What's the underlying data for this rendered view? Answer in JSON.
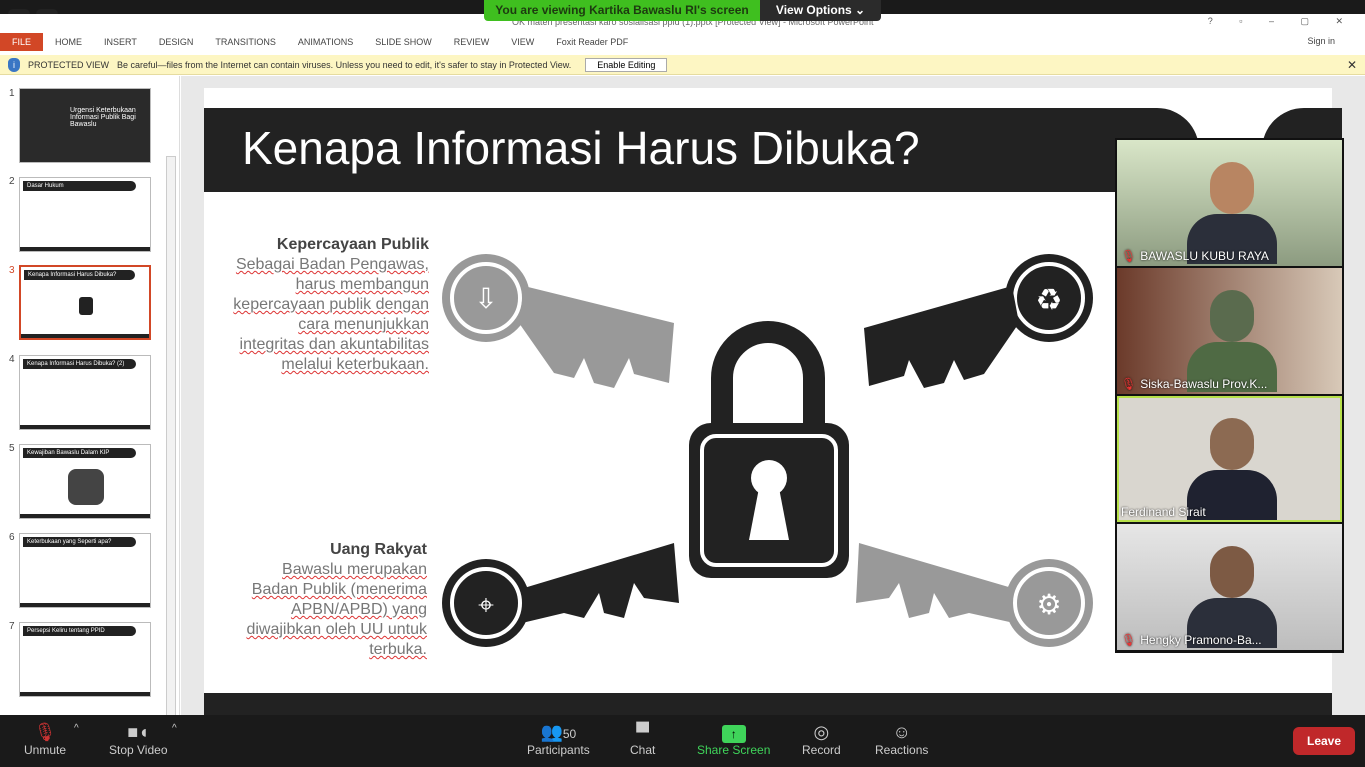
{
  "zoom": {
    "banner": "You are viewing Kartika Bawaslu RI's screen",
    "view_options": "View Options ⌄",
    "toolbar": [
      {
        "label": "Unmute",
        "icon": "mic-muted-icon"
      },
      {
        "label": "Stop Video",
        "icon": "video-camera-icon"
      },
      {
        "label": "Participants",
        "icon": "participants-icon",
        "count": "50"
      },
      {
        "label": "Chat",
        "icon": "chat-icon"
      },
      {
        "label": "Share Screen",
        "icon": "share-screen-icon"
      },
      {
        "label": "Record",
        "icon": "record-icon"
      },
      {
        "label": "Reactions",
        "icon": "reactions-icon"
      }
    ],
    "leave": "Leave",
    "participants": [
      {
        "name": "BAWASLU KUBU RAYA"
      },
      {
        "name": "Siska-Bawaslu Prov.K..."
      },
      {
        "name": "Ferdinand Sirait"
      },
      {
        "name": "Hengky Pramono-Ba..."
      }
    ]
  },
  "window": {
    "title": "OK materi presentasi karo sosialisasi ppid (1).pptx [Protected View] - Microsoft PowerPoint",
    "sign_in": "Sign in"
  },
  "ribbon": {
    "tabs": [
      "FILE",
      "HOME",
      "INSERT",
      "DESIGN",
      "TRANSITIONS",
      "ANIMATIONS",
      "SLIDE SHOW",
      "REVIEW",
      "VIEW",
      "Foxit Reader PDF"
    ]
  },
  "protected": {
    "label": "PROTECTED VIEW",
    "message": "Be careful—files from the Internet can contain viruses. Unless you need to edit, it's safer to stay in Protected View.",
    "button": "Enable Editing"
  },
  "thumbnails": [
    {
      "n": "1",
      "title": "Urgensi Keterbukaan Informasi Publik Bagi Bawaslu"
    },
    {
      "n": "2",
      "title": "Dasar Hukum"
    },
    {
      "n": "3",
      "title": "Kenapa Informasi Harus Dibuka?"
    },
    {
      "n": "4",
      "title": "Kenapa Informasi Harus Dibuka? (2)"
    },
    {
      "n": "5",
      "title": "Kewajiban Bawaslu Dalam KIP"
    },
    {
      "n": "6",
      "title": "Keterbukaan yang Seperti apa?"
    },
    {
      "n": "7",
      "title": "Persepsi Keliru tentang PPID"
    }
  ],
  "slide": {
    "title": "Kenapa Informasi Harus Dibuka?",
    "block1": {
      "heading": "Kepercayaan Publik",
      "lines": [
        "Sebagai Badan Pengawas,",
        "harus membangun",
        "kepercayaan publik dengan",
        "cara menunjukkan",
        "integritas dan akuntabilitas",
        "melalui keterbukaan."
      ]
    },
    "block2": {
      "heading": "Uang Rakyat",
      "lines": [
        "Bawaslu merupakan",
        "Badan Publik (menerima",
        "APBN/APBD) yang",
        "diwajibkan oleh UU untuk",
        "terbuka."
      ]
    },
    "icons": [
      "wifi-download-icon",
      "recycle-icon",
      "map-pin-icon",
      "gears-icon",
      "padlock-icon"
    ]
  }
}
